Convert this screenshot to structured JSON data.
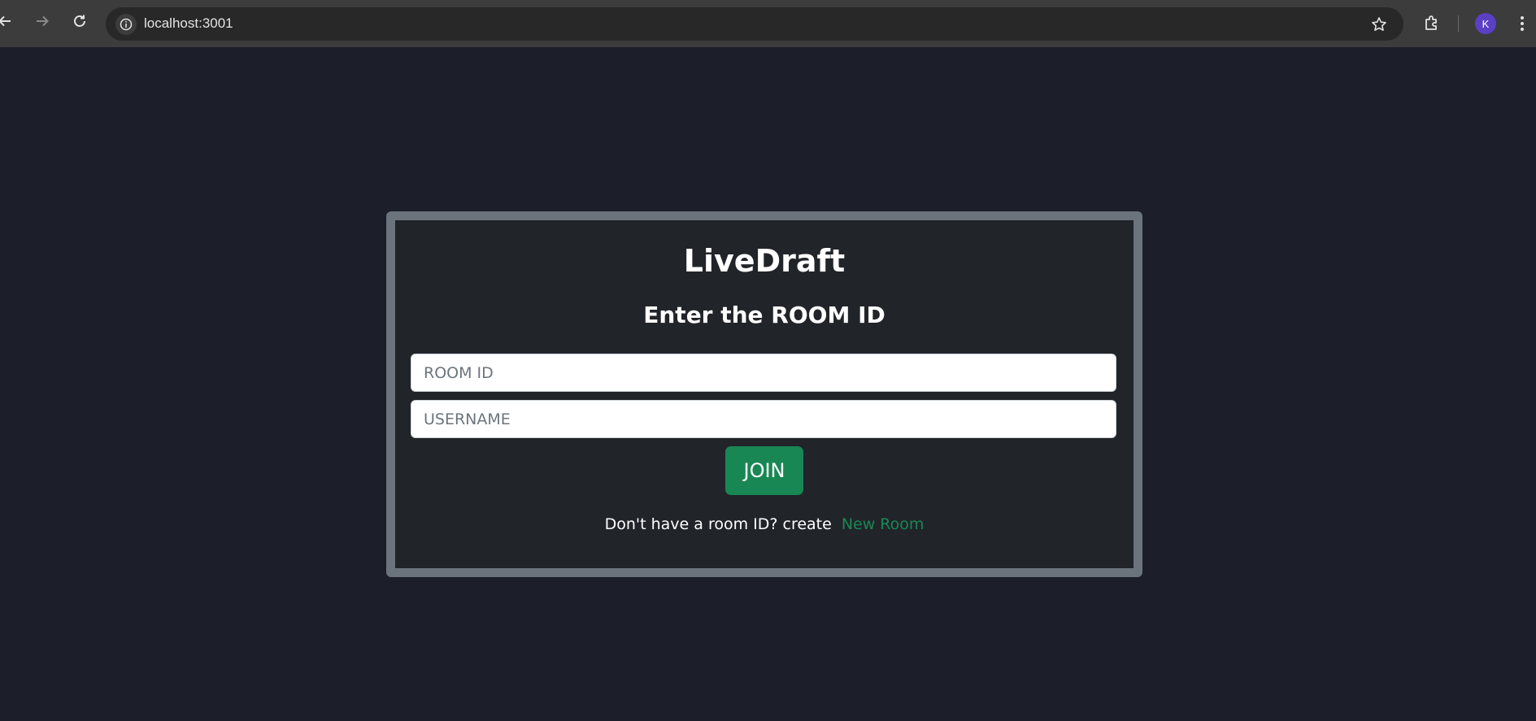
{
  "browser": {
    "url": "localhost:3001",
    "avatar_letter": "K",
    "back_icon": "arrow-left-icon",
    "forward_icon": "arrow-right-icon",
    "reload_icon": "reload-icon",
    "info_icon": "info-icon",
    "bookmark_icon": "star-icon",
    "extensions_icon": "puzzle-icon",
    "menu_icon": "kebab-menu-icon"
  },
  "page": {
    "title": "LiveDraft",
    "subtitle": "Enter the ROOM ID",
    "room_input": {
      "placeholder": "ROOM ID",
      "value": ""
    },
    "username_input": {
      "placeholder": "USERNAME",
      "value": ""
    },
    "join_label": "JOIN",
    "footer_text": "Don't have a room ID? create",
    "new_room_link": "New Room"
  },
  "colors": {
    "background": "#1c1e2a",
    "card_border": "#6b737c",
    "card_bg": "#212429",
    "accent_green": "#198754",
    "text": "#ffffff"
  }
}
